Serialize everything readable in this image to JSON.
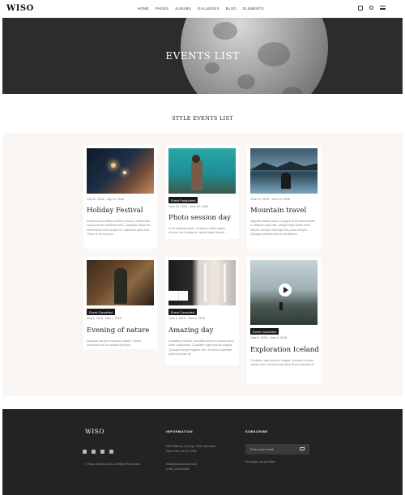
{
  "header": {
    "logo": "WISO",
    "nav": [
      "HOME",
      "PAGES",
      "ALBUMS",
      "GALLERIES",
      "BLOG",
      "ELEMENTS"
    ]
  },
  "hero": {
    "title": "EVENTS LIST"
  },
  "section": {
    "title": "STYLE EVENTS LIST"
  },
  "events": [
    {
      "badge": "",
      "date": "July 30, 2018 - July 31, 2018",
      "title": "Holiday Festival",
      "desc": "Donec porta metus a libero cursus, vestibulum cursus tortor condimentum. Curabitur tortor leo, elementum sed congue in, maximus quis eros. There is no excerpt."
    },
    {
      "badge": "Event Postponed",
      "date": "June 29, 2018 - June 30, 2018",
      "title": "Photo session day",
      "desc": "In at volutpat quam. Quisque metus ligula, viverra nec feugiat ut, lacinia eget mauris."
    },
    {
      "badge": "",
      "date": "June 13, 2018 - June 14, 2018",
      "title": "Mountain travel",
      "desc": "Aliquam massa dolor, congue id sit amet rutrum a, aliquam quis nisl. Integer eget lorem ante. Mauris semper velit eget est porta tempor. Quisque pretium sed mi at ultrices."
    },
    {
      "badge": "Event Cancelled",
      "date": "May 1, 2018 - May 1, 2018",
      "title": "Evening of nature",
      "desc": "Quisque semper euismod sapien. Etiam maximus nisi id volutpat tempus."
    },
    {
      "badge": "Event Cancelled",
      "date": "June 5, 2018 - June 6, 2018",
      "title": "Amazing day",
      "desc": "Curabitur pretium convallis lorem et dictum arcu dolor sollicitudin. Curabitur eget mauris magna. Quisque tempor sapien nisi, rhoncus imperdiet quam lobortis at."
    },
    {
      "badge": "Event Cancelled",
      "date": "June 5, 2018 - June 6, 2018",
      "title": "Exploration Iceland",
      "desc": "Curabitur eget mauris magna. Quisque tempor sapien nisi, rhoncus imperdiet quam lobortis at."
    }
  ],
  "footer": {
    "logo": "WISO",
    "copyright": "© Wiso Studio 2018. All Right Reserved.",
    "info_heading": "INFORMATION",
    "address_1": "2505 Stoney Ore Apt. 896, Wenzelle,",
    "address_2": "New York 10013, USA",
    "email": "info@yourdomain.com",
    "phone": "(+68) 120034509",
    "subscribe_heading": "SUBSCRIBE",
    "subscribe_placeholder": "Enter your email",
    "spam_note": "No spam, we promise"
  }
}
